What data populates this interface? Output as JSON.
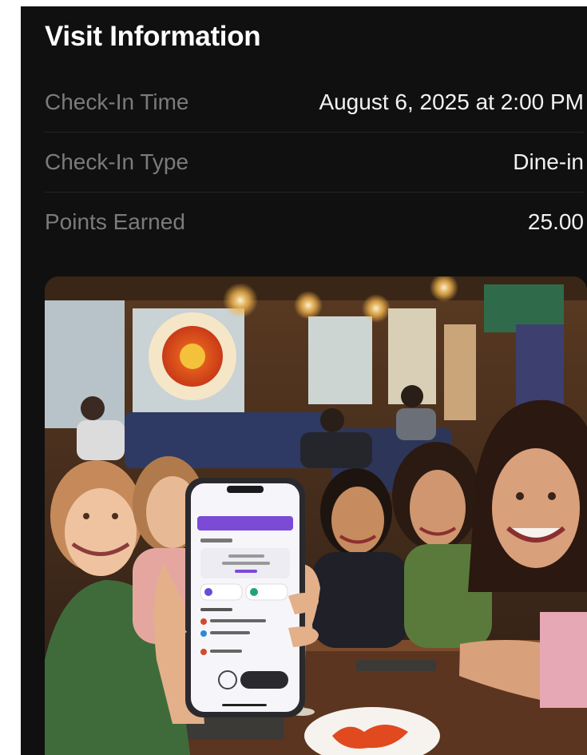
{
  "visit": {
    "title": "Visit Information",
    "rows": [
      {
        "label": "Check-In Time",
        "value": "August 6, 2025 at 2:00 PM"
      },
      {
        "label": "Check-In Type",
        "value": "Dine-in"
      },
      {
        "label": "Points Earned",
        "value": "25.00"
      }
    ]
  },
  "photo": {
    "subject": "friends at restaurant table holding phone with app"
  },
  "colors": {
    "background": "#101010",
    "label": "#7b7b7b",
    "value": "#f2f2f2",
    "accent": "#7b4bd6"
  }
}
